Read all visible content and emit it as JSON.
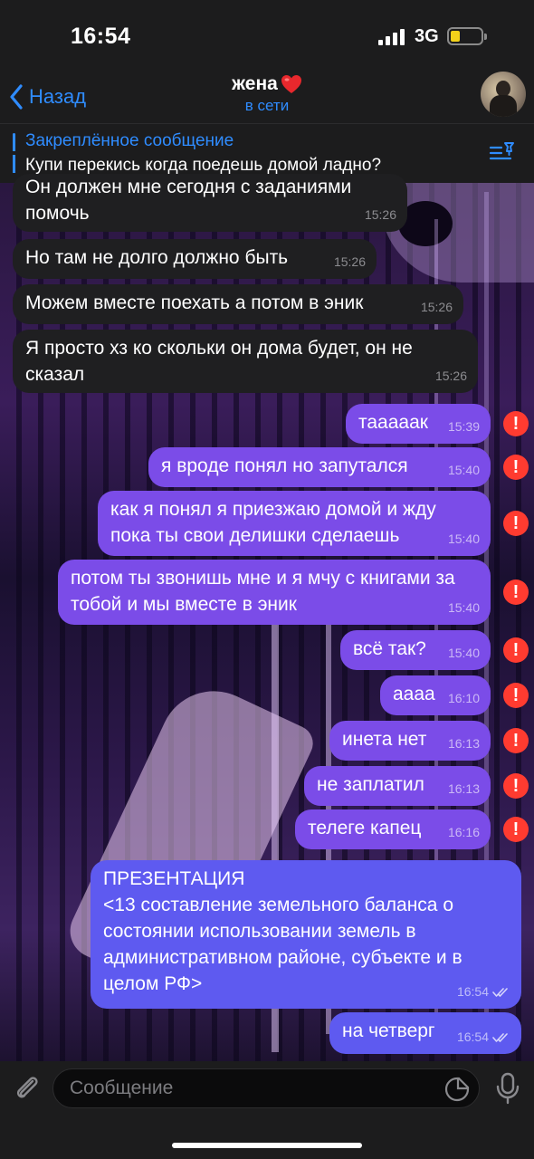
{
  "status_bar": {
    "time": "16:54",
    "network": "3G"
  },
  "header": {
    "back_label": "Назад",
    "title": "жена",
    "subtitle": "в сети"
  },
  "pinned": {
    "title": "Закреплённое сообщение",
    "text": "Купи перекись когда поедешь домой ладно?"
  },
  "messages": [
    {
      "dir": "in",
      "text": "Он должен мне сегодня с заданиями помочь",
      "time": "15:26"
    },
    {
      "dir": "in",
      "text": "Но там не долго должно быть",
      "time": "15:26"
    },
    {
      "dir": "in",
      "text": "Можем вместе поехать а потом в эник",
      "time": "15:26"
    },
    {
      "dir": "in",
      "text": "Я просто хз ко скольки он дома будет, он не сказал",
      "time": "15:26"
    },
    {
      "dir": "out",
      "text": "таааaак",
      "time": "15:39",
      "error": true
    },
    {
      "dir": "out",
      "text": "я вроде понял но запутался",
      "time": "15:40",
      "error": true
    },
    {
      "dir": "out",
      "text": "как я понял я приезжаю домой и жду пока ты свои делишки сделаешь",
      "time": "15:40",
      "error": true
    },
    {
      "dir": "out",
      "text": "потом ты звонишь мне и я мчу с книгами за тобой и мы вместе в эник",
      "time": "15:40",
      "error": true
    },
    {
      "dir": "out",
      "text": "всё так?",
      "time": "15:40",
      "error": true
    },
    {
      "dir": "out",
      "text": "аааа",
      "time": "16:10",
      "error": true
    },
    {
      "dir": "out",
      "text": "инета нет",
      "time": "16:13",
      "error": true
    },
    {
      "dir": "out",
      "text": "не заплатил",
      "time": "16:13",
      "error": true
    },
    {
      "dir": "out",
      "text": "телеге капец",
      "time": "16:16",
      "error": true
    },
    {
      "dir": "out",
      "text": "ПРЕЗЕНТАЦИЯ\n<13 составление земельного баланса о состоянии использовании земель в административном районе, субъекте и в целом РФ>",
      "time": "16:54",
      "read": true
    },
    {
      "dir": "out",
      "text": "на четверг",
      "time": "16:54",
      "read": true
    }
  ],
  "input": {
    "placeholder": "Сообщение"
  },
  "colors": {
    "accent": "#2f8cff",
    "outgoing": "#7b4ce8",
    "incoming": "#1f1f21",
    "error": "#ff3b30"
  },
  "icons": [
    "chevron-left-icon",
    "heart-emoji-icon",
    "pinned-list-icon",
    "error-icon",
    "double-check-icon",
    "paperclip-icon",
    "sticker-icon",
    "microphone-icon"
  ]
}
